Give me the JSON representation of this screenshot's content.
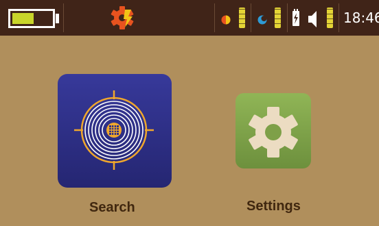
{
  "status_bar": {
    "battery": {
      "icon": "battery-icon",
      "level": 0.55,
      "fill_color": "#c9d52a"
    },
    "settings_alert": {
      "icon": "gear-lightning-icon",
      "color": "#e8531f",
      "bolt_color": "#f3c316"
    },
    "indicators": [
      {
        "icon": "brightness-icon",
        "level": 1.0
      },
      {
        "icon": "contrast-icon",
        "level": 1.0
      },
      {
        "icon": "power-plug-icon",
        "level": null
      },
      {
        "icon": "speaker-icon",
        "level": 1.0
      }
    ],
    "time": "18:46"
  },
  "apps": [
    {
      "id": "search",
      "label": "Search",
      "icon": "target-icon",
      "color": "#2e2f86"
    },
    {
      "id": "settings",
      "label": "Settings",
      "icon": "gear-icon",
      "color": "#7ea048"
    }
  ]
}
